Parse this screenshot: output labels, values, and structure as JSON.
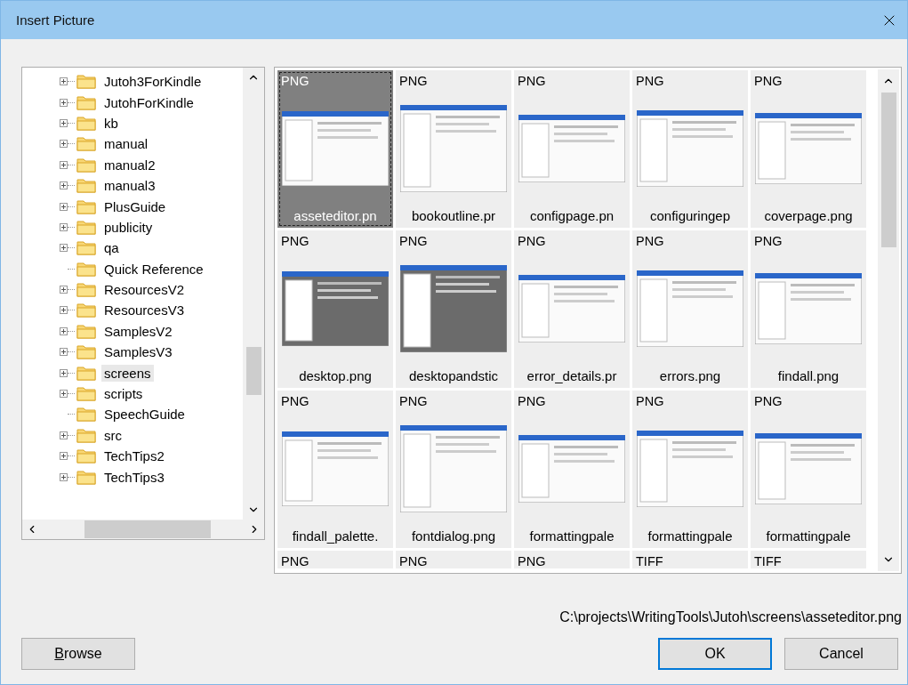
{
  "window": {
    "title": "Insert Picture"
  },
  "folder_tree": {
    "items": [
      {
        "label": "Jutoh3ForKindle",
        "expandable": true,
        "selected": false
      },
      {
        "label": "JutohForKindle",
        "expandable": true,
        "selected": false
      },
      {
        "label": "kb",
        "expandable": true,
        "selected": false
      },
      {
        "label": "manual",
        "expandable": true,
        "selected": false
      },
      {
        "label": "manual2",
        "expandable": true,
        "selected": false
      },
      {
        "label": "manual3",
        "expandable": true,
        "selected": false
      },
      {
        "label": "PlusGuide",
        "expandable": true,
        "selected": false
      },
      {
        "label": "publicity",
        "expandable": true,
        "selected": false
      },
      {
        "label": "qa",
        "expandable": true,
        "selected": false
      },
      {
        "label": "Quick Reference",
        "expandable": false,
        "selected": false
      },
      {
        "label": "ResourcesV2",
        "expandable": true,
        "selected": false
      },
      {
        "label": "ResourcesV3",
        "expandable": true,
        "selected": false
      },
      {
        "label": "SamplesV2",
        "expandable": true,
        "selected": false
      },
      {
        "label": "SamplesV3",
        "expandable": true,
        "selected": false
      },
      {
        "label": "screens",
        "expandable": true,
        "selected": true
      },
      {
        "label": "scripts",
        "expandable": true,
        "selected": false
      },
      {
        "label": "SpeechGuide",
        "expandable": false,
        "selected": false
      },
      {
        "label": "src",
        "expandable": true,
        "selected": false
      },
      {
        "label": "TechTips2",
        "expandable": true,
        "selected": false
      },
      {
        "label": "TechTips3",
        "expandable": true,
        "selected": false
      }
    ]
  },
  "thumbnails": [
    {
      "type": "PNG",
      "name": "asseteditor.pn",
      "selected": true,
      "has_thumbnail": true
    },
    {
      "type": "PNG",
      "name": "bookoutline.pr",
      "selected": false,
      "has_thumbnail": true
    },
    {
      "type": "PNG",
      "name": "configpage.pn",
      "selected": false,
      "has_thumbnail": true
    },
    {
      "type": "PNG",
      "name": "configuringep",
      "selected": false,
      "has_thumbnail": true
    },
    {
      "type": "PNG",
      "name": "coverpage.png",
      "selected": false,
      "has_thumbnail": true
    },
    {
      "type": "PNG",
      "name": "desktop.png",
      "selected": false,
      "has_thumbnail": true
    },
    {
      "type": "PNG",
      "name": "desktopandstic",
      "selected": false,
      "has_thumbnail": true
    },
    {
      "type": "PNG",
      "name": "error_details.pr",
      "selected": false,
      "has_thumbnail": true
    },
    {
      "type": "PNG",
      "name": "errors.png",
      "selected": false,
      "has_thumbnail": true
    },
    {
      "type": "PNG",
      "name": "findall.png",
      "selected": false,
      "has_thumbnail": true
    },
    {
      "type": "PNG",
      "name": "findall_palette.",
      "selected": false,
      "has_thumbnail": true
    },
    {
      "type": "PNG",
      "name": "fontdialog.png",
      "selected": false,
      "has_thumbnail": true
    },
    {
      "type": "PNG",
      "name": "formattingpale",
      "selected": false,
      "has_thumbnail": true
    },
    {
      "type": "PNG",
      "name": "formattingpale",
      "selected": false,
      "has_thumbnail": true
    },
    {
      "type": "PNG",
      "name": "formattingpale",
      "selected": false,
      "has_thumbnail": true
    },
    {
      "type": "PNG",
      "selected": false,
      "has_thumbnail": false
    },
    {
      "type": "PNG",
      "selected": false,
      "has_thumbnail": false
    },
    {
      "type": "PNG",
      "selected": false,
      "has_thumbnail": false
    },
    {
      "type": "TIFF",
      "selected": false,
      "has_thumbnail": false
    },
    {
      "type": "TIFF",
      "selected": false,
      "has_thumbnail": false
    }
  ],
  "path": "C:\\projects\\WritingTools\\Jutoh\\screens\\asseteditor.png",
  "buttons": [
    {
      "label": "Browse",
      "underline_first": true,
      "default": false
    },
    {
      "label": "OK",
      "underline_first": false,
      "default": true
    },
    {
      "label": "Cancel",
      "underline_first": false,
      "default": false
    }
  ]
}
